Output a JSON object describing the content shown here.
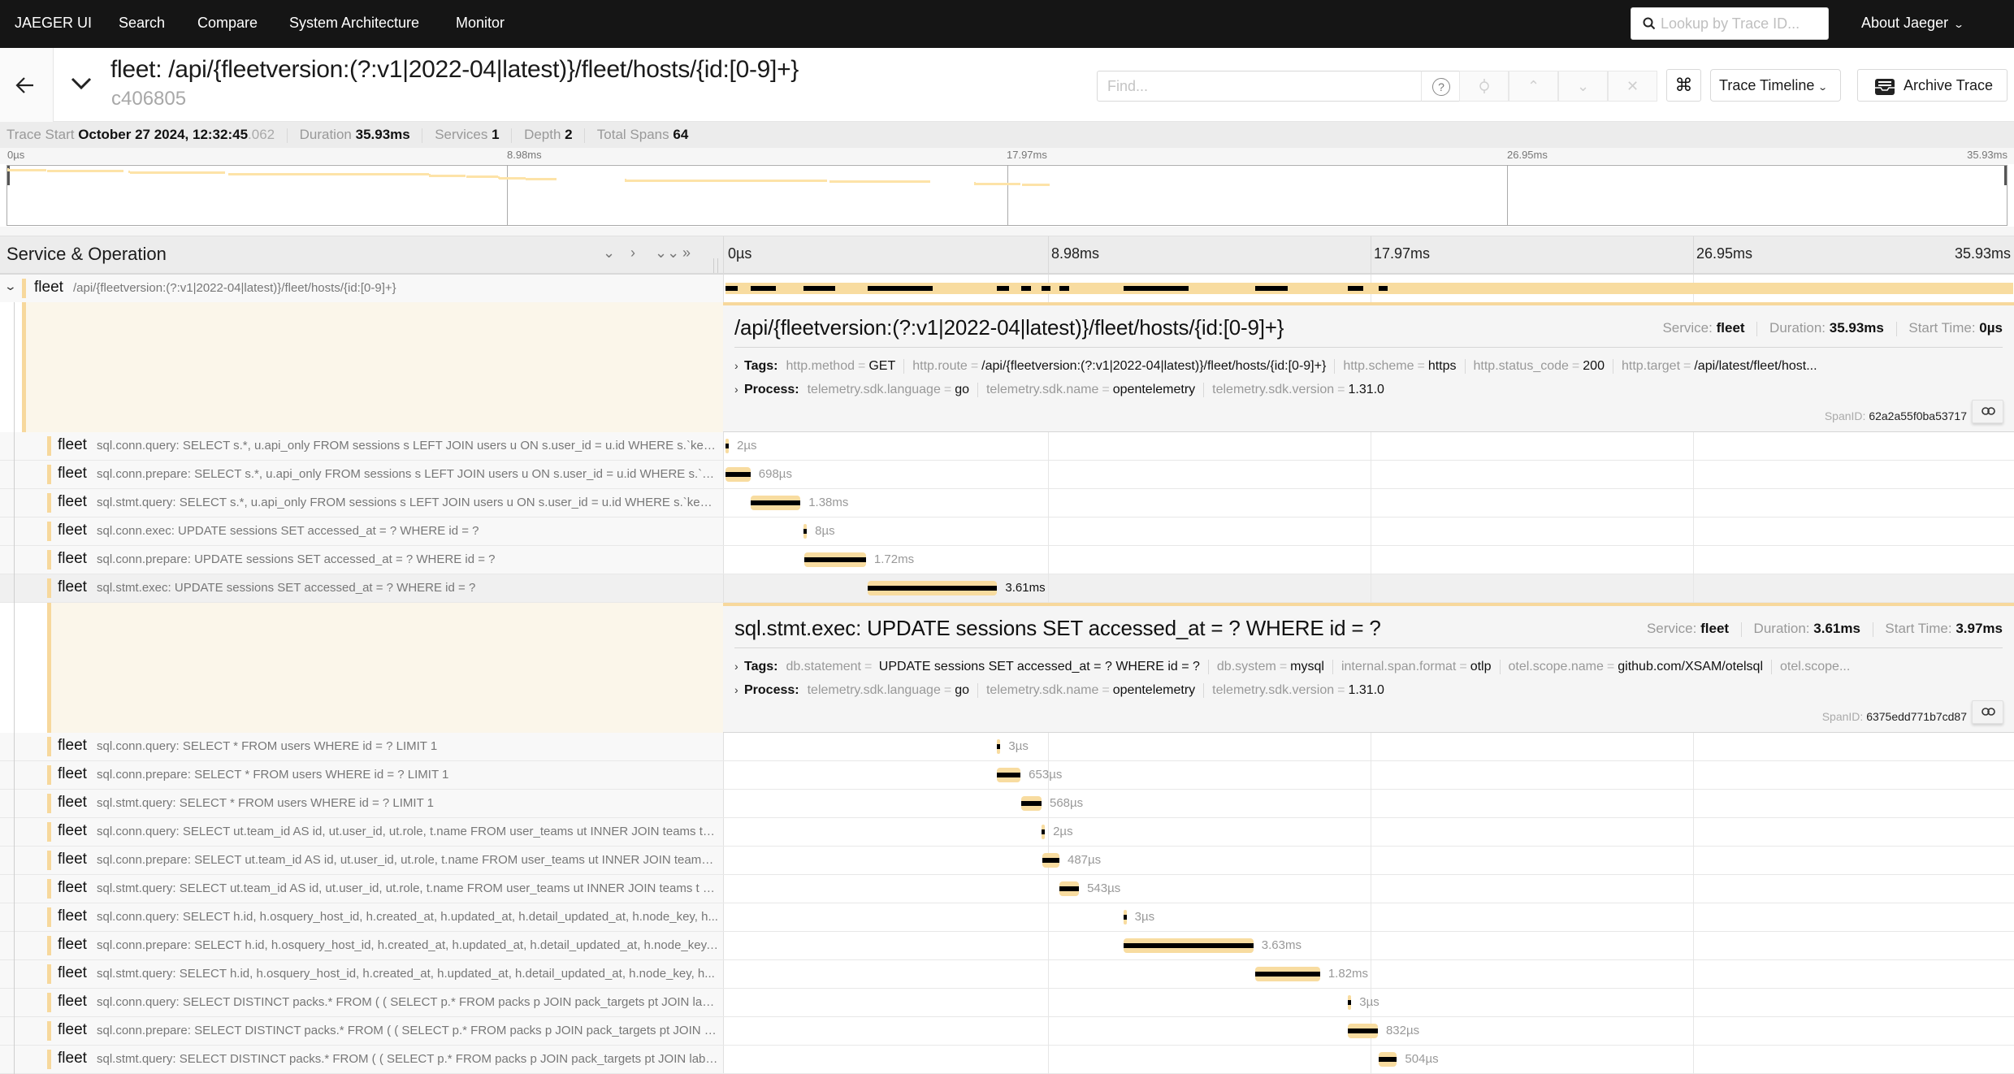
{
  "topnav": {
    "brand": "JAEGER UI",
    "items": [
      "Search",
      "Compare",
      "System Architecture",
      "Monitor"
    ],
    "lookup_placeholder": "Lookup by Trace ID...",
    "about": "About Jaeger"
  },
  "trace": {
    "title": "fleet: /api/{fleetversion:(?:v1|2022-04|latest)}/fleet/hosts/{id:[0-9]+}",
    "id": "c406805",
    "find_placeholder": "Find...",
    "help_glyph": "?",
    "view_select": "Trace Timeline",
    "archive_label": "Archive Trace",
    "cmd_glyph": "⌘"
  },
  "info": {
    "start_label": "Trace Start",
    "start_value": "October 27 2024, 12:32:45",
    "start_ms": ".062",
    "duration_label": "Duration",
    "duration_value": "35.93ms",
    "services_label": "Services",
    "services_value": "1",
    "depth_label": "Depth",
    "depth_value": "2",
    "spans_label": "Total Spans",
    "spans_value": "64"
  },
  "ticks": [
    "0µs",
    "8.98ms",
    "17.97ms",
    "26.95ms",
    "35.93ms"
  ],
  "trace_duration_ms": 35.93,
  "table_header": {
    "title": "Service & Operation",
    "controls": [
      "collapse-one",
      "expand-one",
      "collapse-all",
      "expand-all"
    ]
  },
  "colors": {
    "service_fleet": "#f7d89c",
    "critical_path": "#000000",
    "topnav_bg": "#151515"
  },
  "root": {
    "service": "fleet",
    "operation": "/api/{fleetversion:(?:v1|2022-04|latest)}/fleet/hosts/{id:[0-9]+}",
    "detail": {
      "title": "/api/{fleetversion:(?:v1|2022-04|latest)}/fleet/hosts/{id:[0-9]+}",
      "service_label": "Service:",
      "service": "fleet",
      "duration_label": "Duration:",
      "duration": "35.93ms",
      "start_label": "Start Time:",
      "start": "0µs",
      "tags_label": "Tags:",
      "tags": [
        {
          "k": "http.method",
          "v": "GET"
        },
        {
          "k": "http.route",
          "v": "/api/{fleetversion:(?:v1|2022-04|latest)}/fleet/hosts/{id:[0-9]+}"
        },
        {
          "k": "http.scheme",
          "v": "https"
        },
        {
          "k": "http.status_code",
          "v": "200"
        },
        {
          "k": "http.target",
          "v": "/api/latest/fleet/host..."
        }
      ],
      "process_label": "Process:",
      "process": [
        {
          "k": "telemetry.sdk.language",
          "v": "go"
        },
        {
          "k": "telemetry.sdk.name",
          "v": "opentelemetry"
        },
        {
          "k": "telemetry.sdk.version",
          "v": "1.31.0"
        }
      ],
      "span_id_label": "SpanID:",
      "span_id": "62a2a55f0ba53717"
    }
  },
  "spans_a": [
    {
      "service": "fleet",
      "operation": "sql.conn.query: SELECT s.*, u.api_only FROM sessions s LEFT JOIN users u ON s.user_id = u.id WHERE s.`key` =...",
      "start_ms": 0.0,
      "duration_ms": 0.002,
      "label": "2µs"
    },
    {
      "service": "fleet",
      "operation": "sql.conn.prepare: SELECT s.*, u.api_only FROM sessions s LEFT JOIN users u ON s.user_id = u.id WHERE s.`key`...",
      "start_ms": 0.0,
      "duration_ms": 0.698,
      "label": "698µs"
    },
    {
      "service": "fleet",
      "operation": "sql.stmt.query: SELECT s.*, u.api_only FROM sessions s LEFT JOIN users u ON s.user_id = u.id WHERE s.`key` = ...",
      "start_ms": 0.71,
      "duration_ms": 1.38,
      "label": "1.38ms"
    },
    {
      "service": "fleet",
      "operation": "sql.conn.exec: UPDATE sessions SET accessed_at = ? WHERE id = ?",
      "start_ms": 2.18,
      "duration_ms": 0.008,
      "label": "8µs"
    },
    {
      "service": "fleet",
      "operation": "sql.conn.prepare: UPDATE sessions SET accessed_at = ? WHERE id = ?",
      "start_ms": 2.2,
      "duration_ms": 1.72,
      "label": "1.72ms"
    },
    {
      "service": "fleet",
      "operation": "sql.stmt.exec: UPDATE sessions SET accessed_at = ? WHERE id = ?",
      "start_ms": 3.97,
      "duration_ms": 3.61,
      "label": "3.61ms",
      "selected": true
    }
  ],
  "selected_detail": {
    "title": "sql.stmt.exec: UPDATE sessions SET accessed_at = ? WHERE id = ?",
    "service_label": "Service:",
    "service": "fleet",
    "duration_label": "Duration:",
    "duration": "3.61ms",
    "start_label": "Start Time:",
    "start": "3.97ms",
    "tags_label": "Tags:",
    "tags": [
      {
        "k": "db.statement",
        "v": " UPDATE sessions SET accessed_at = ? WHERE id = ?"
      },
      {
        "k": "db.system",
        "v": "mysql"
      },
      {
        "k": "internal.span.format",
        "v": "otlp"
      },
      {
        "k": "otel.scope.name",
        "v": "github.com/XSAM/otelsql"
      },
      {
        "k": "otel.scope...",
        "v": ""
      }
    ],
    "process_label": "Process:",
    "process": [
      {
        "k": "telemetry.sdk.language",
        "v": "go"
      },
      {
        "k": "telemetry.sdk.name",
        "v": "opentelemetry"
      },
      {
        "k": "telemetry.sdk.version",
        "v": "1.31.0"
      }
    ],
    "span_id_label": "SpanID:",
    "span_id": "6375edd771b7cd87"
  },
  "spans_b": [
    {
      "service": "fleet",
      "operation": "sql.conn.query: SELECT * FROM users WHERE id = ? LIMIT 1",
      "start_ms": 7.58,
      "duration_ms": 0.003,
      "label": "3µs"
    },
    {
      "service": "fleet",
      "operation": "sql.conn.prepare: SELECT * FROM users WHERE id = ? LIMIT 1",
      "start_ms": 7.58,
      "duration_ms": 0.653,
      "label": "653µs"
    },
    {
      "service": "fleet",
      "operation": "sql.stmt.query: SELECT * FROM users WHERE id = ? LIMIT 1",
      "start_ms": 8.25,
      "duration_ms": 0.568,
      "label": "568µs"
    },
    {
      "service": "fleet",
      "operation": "sql.conn.query: SELECT ut.team_id AS id, ut.user_id, ut.role, t.name FROM user_teams ut INNER JOIN teams t O...",
      "start_ms": 8.82,
      "duration_ms": 0.002,
      "label": "2µs"
    },
    {
      "service": "fleet",
      "operation": "sql.conn.prepare: SELECT ut.team_id AS id, ut.user_id, ut.role, t.name FROM user_teams ut INNER JOIN teams t ...",
      "start_ms": 8.83,
      "duration_ms": 0.487,
      "label": "487µs"
    },
    {
      "service": "fleet",
      "operation": "sql.stmt.query: SELECT ut.team_id AS id, ut.user_id, ut.role, t.name FROM user_teams ut INNER JOIN teams t O...",
      "start_ms": 9.32,
      "duration_ms": 0.543,
      "label": "543µs"
    },
    {
      "service": "fleet",
      "operation": "sql.conn.query: SELECT h.id, h.osquery_host_id, h.created_at, h.updated_at, h.detail_updated_at, h.node_key, h...",
      "start_ms": 11.1,
      "duration_ms": 0.003,
      "label": "3µs"
    },
    {
      "service": "fleet",
      "operation": "sql.conn.prepare: SELECT h.id, h.osquery_host_id, h.created_at, h.updated_at, h.detail_updated_at, h.node_key,...",
      "start_ms": 11.1,
      "duration_ms": 3.63,
      "label": "3.63ms"
    },
    {
      "service": "fleet",
      "operation": "sql.stmt.query: SELECT h.id, h.osquery_host_id, h.created_at, h.updated_at, h.detail_updated_at, h.node_key, h...",
      "start_ms": 14.77,
      "duration_ms": 1.82,
      "label": "1.82ms"
    },
    {
      "service": "fleet",
      "operation": "sql.conn.query: SELECT DISTINCT packs.* FROM ( ( SELECT p.* FROM packs p JOIN pack_targets pt JOIN label_...",
      "start_ms": 17.37,
      "duration_ms": 0.003,
      "label": "3µs"
    },
    {
      "service": "fleet",
      "operation": "sql.conn.prepare: SELECT DISTINCT packs.* FROM ( ( SELECT p.* FROM packs p JOIN pack_targets pt JOIN labe...",
      "start_ms": 17.37,
      "duration_ms": 0.832,
      "label": "832µs"
    },
    {
      "service": "fleet",
      "operation": "sql.stmt.query: SELECT DISTINCT packs.* FROM ( ( SELECT p.* FROM packs p JOIN pack_targets pt JOIN label_...",
      "start_ms": 18.23,
      "duration_ms": 0.504,
      "label": "504µs"
    }
  ]
}
